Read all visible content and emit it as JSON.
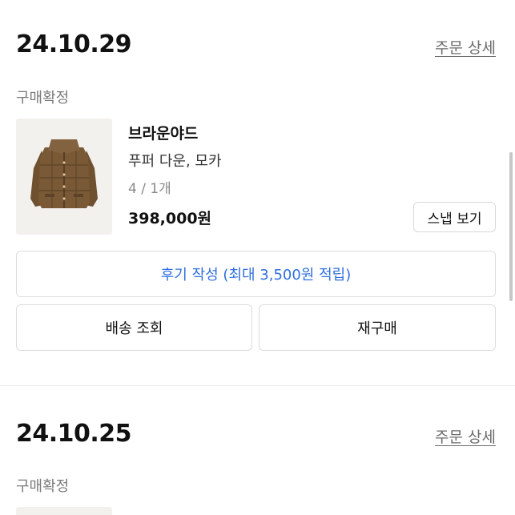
{
  "orders": [
    {
      "date": "24.10.29",
      "detail_link": "주문 상세",
      "status": "구매확정",
      "item": {
        "brand": "브라운야드",
        "name": "푸퍼 다운, 모카",
        "option": "4 / 1개",
        "price": "398,000원",
        "snap_button": "스냅 보기",
        "image": "brown-puffer-down-jacket"
      },
      "review_button": "후기 작성 (최대 3,500원 적립)",
      "shipping_button": "배송 조회",
      "reorder_button": "재구매"
    },
    {
      "date": "24.10.25",
      "detail_link": "주문 상세",
      "status": "구매확정"
    }
  ],
  "colors": {
    "accent_blue": "#2f6fe0",
    "muted_gray": "#7a7a7a",
    "jacket_brown": "#7a5a36"
  }
}
